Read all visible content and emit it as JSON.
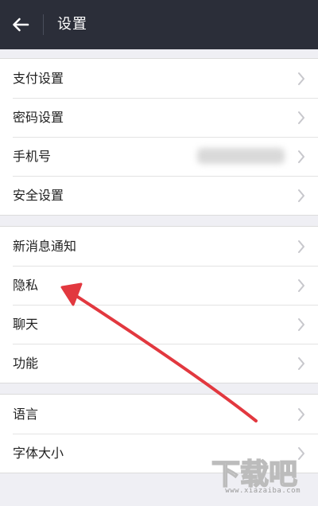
{
  "header": {
    "title": "设置",
    "back_icon": "back-arrow-icon"
  },
  "groups": [
    {
      "items": [
        {
          "label": "支付设置"
        },
        {
          "label": "密码设置"
        },
        {
          "label": "手机号",
          "value_blurred": true
        },
        {
          "label": "安全设置"
        }
      ]
    },
    {
      "items": [
        {
          "label": "新消息通知"
        },
        {
          "label": "隐私",
          "highlighted_by_arrow": true
        },
        {
          "label": "聊天"
        },
        {
          "label": "功能"
        }
      ]
    },
    {
      "items": [
        {
          "label": "语言"
        },
        {
          "label": "字体大小"
        }
      ]
    }
  ],
  "annotation": {
    "arrow_color": "#e2383f"
  },
  "watermark": {
    "brand": "下载吧",
    "url": "www.xiazaiba.com"
  },
  "colors": {
    "header_bg": "#2b2e39",
    "page_bg": "#efeff4",
    "row_bg": "#ffffff",
    "chevron": "#c7c7cc"
  }
}
